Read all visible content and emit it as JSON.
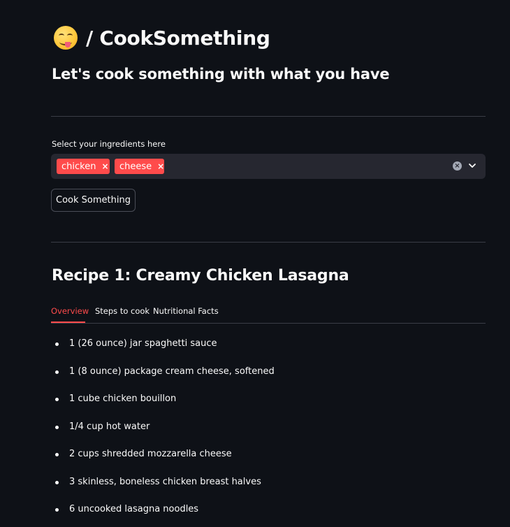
{
  "header": {
    "title_emoji": "😋",
    "title": "/ CookSomething",
    "subtitle": "Let's cook something with what you have"
  },
  "ingredient_select": {
    "label": "Select your ingredients here",
    "selected": [
      {
        "label": "chicken",
        "remove": "×"
      },
      {
        "label": "cheese",
        "remove": "×"
      }
    ],
    "clear_glyph": "×"
  },
  "cook_button": {
    "label": "Cook Something"
  },
  "recipe": {
    "title": "Recipe 1: Creamy Chicken Lasagna",
    "tabs": [
      {
        "label": "Overview",
        "active": true
      },
      {
        "label": "Steps to cook",
        "active": false
      },
      {
        "label": "Nutritional Facts",
        "active": false
      }
    ],
    "ingredients": [
      "1 (26 ounce) jar spaghetti sauce",
      "1 (8 ounce) package cream cheese, softened",
      "1 cube chicken bouillon",
      "1/4 cup hot water",
      "2 cups shredded mozzarella cheese",
      "3 skinless, boneless chicken breast halves",
      "6 uncooked lasagna noodles"
    ]
  },
  "colors": {
    "background": "#0e1117",
    "accent": "#ff4b4b",
    "input_bg": "#262730",
    "text": "#fafafa"
  }
}
